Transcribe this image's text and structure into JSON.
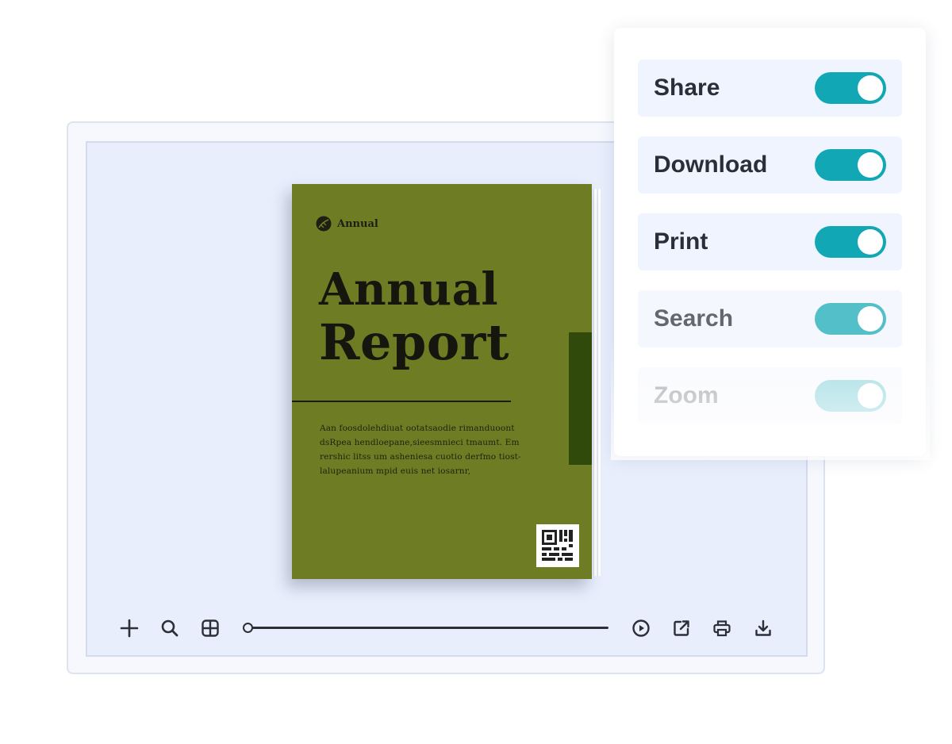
{
  "book": {
    "brand_label": "Annual",
    "title_line1": "Annual",
    "title_line2": "Report",
    "body_text": "Aan foosdolehdiuat ootatsaodie rimanduoont dsRpea hendloepane,sieesmnieci tmaumt. Em rershic litss um asheniesa cuotio derfmo tiost-lalupeanium mpid euis net iosarnr,",
    "cover_color": "#6e7d23",
    "accent_color": "#2f4a0b",
    "icons": [
      "leaf-logo-icon",
      "qr-code-icon"
    ]
  },
  "toolbar": {
    "left_buttons": [
      "zoom-in-icon",
      "search-icon",
      "thumbnails-icon"
    ],
    "right_buttons": [
      "autoplay-icon",
      "share-icon",
      "print-icon",
      "download-icon"
    ],
    "page_position": 0
  },
  "settings": {
    "items": [
      {
        "label": "Share",
        "enabled": true
      },
      {
        "label": "Download",
        "enabled": true
      },
      {
        "label": "Print",
        "enabled": true
      },
      {
        "label": "Search",
        "enabled": true
      },
      {
        "label": "Zoom",
        "enabled": true
      }
    ],
    "toggle_color": "#12a7b4"
  }
}
